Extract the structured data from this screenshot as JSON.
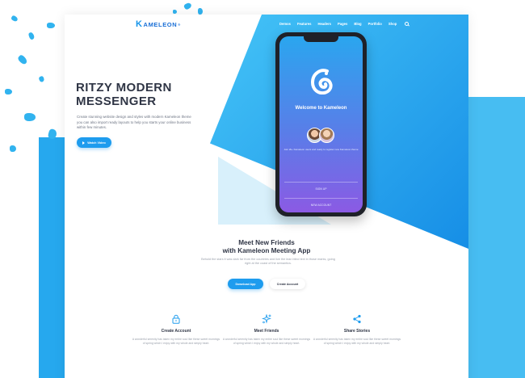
{
  "brand": {
    "accent": "#1e9cee",
    "logo_letter": "K",
    "logo_text": "AMELEON",
    "logo_mark": "®"
  },
  "nav": {
    "items": [
      "Demos",
      "Features",
      "Headers",
      "Pages",
      "Blog",
      "Portfolio",
      "Shop"
    ],
    "search_icon": "search-icon"
  },
  "hero": {
    "title_line1": "RITZY MODERN",
    "title_line2": "MESSENGER",
    "description": "Create stunning website design and styles with modern Kameleon theme you can also import ready layouts to help you starts your online business within few minutes.",
    "button_label": "Watch Video",
    "button_icon": "play-icon"
  },
  "phone": {
    "welcome": "Welcome to Kameleon",
    "users_text": "Join 2k+ Kameleon users and ready to register new Kameleon theme",
    "signup_label": "SIGN UP",
    "new_account_label": "NEW ACCOUNT"
  },
  "section": {
    "title_line1": "Meet New Friends",
    "title_line2": "with Kameleon Meeting App",
    "description": "Behold the stars it was dark far from the countries and live the lean blind text in those marks, going right at the coast of the semantics.",
    "primary_button": "Download App",
    "secondary_button": "Create Account"
  },
  "features": [
    {
      "icon": "lock-icon",
      "title": "Create Account",
      "text": "A wonderful serenity has taken my entire soul like these sweet mornings of spring which I enjoy with my whole and simply heart."
    },
    {
      "icon": "sparkle-icon",
      "title": "Meet Friends",
      "text": "A wonderful serenity has taken my entire soul like these sweet mornings of spring which I enjoy with my whole and simply heart."
    },
    {
      "icon": "share-icon",
      "title": "Share Stories",
      "text": "A wonderful serenity has taken my entire soul like these sweet mornings of spring which I enjoy with my whole and simply heart."
    }
  ]
}
